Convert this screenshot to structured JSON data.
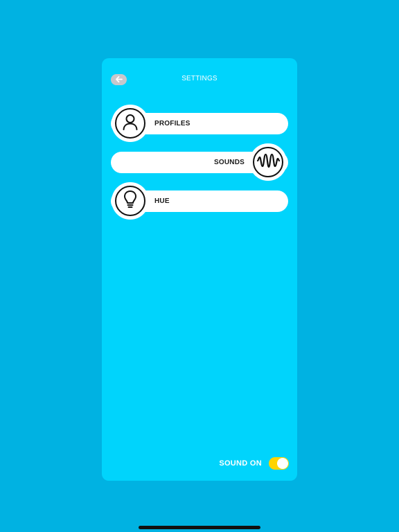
{
  "header": {
    "title": "SETTINGS",
    "back_icon": "arrow-left-icon"
  },
  "menu": {
    "items": [
      {
        "label": "PROFILES",
        "icon": "user-icon"
      },
      {
        "label": "SOUNDS",
        "icon": "sound-wave-icon"
      },
      {
        "label": "HUE",
        "icon": "lightbulb-icon"
      }
    ]
  },
  "footer": {
    "sound_label": "SOUND ON",
    "sound_enabled": true
  },
  "colors": {
    "background": "#00B2E2",
    "panel": "#00D4FC",
    "toggle_on": "#FFD400"
  }
}
